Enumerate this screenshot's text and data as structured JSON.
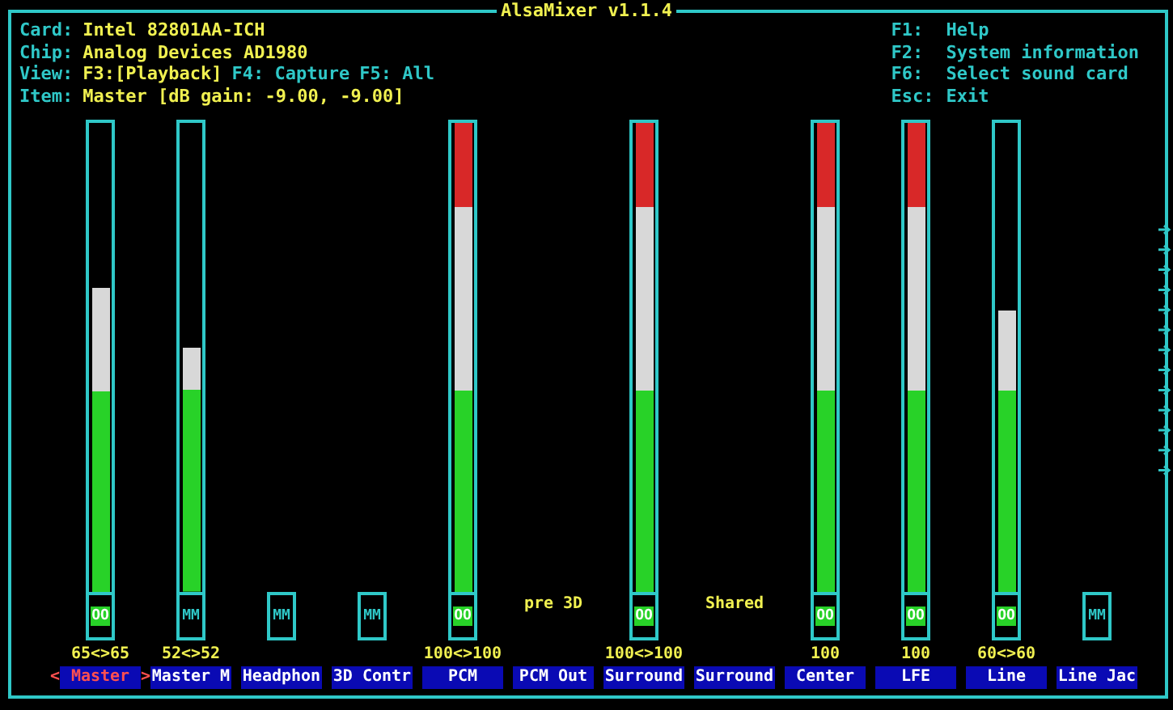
{
  "title": "AlsaMixer v1.1.4",
  "info": [
    {
      "label": "Card:",
      "value": "Intel 82801AA-ICH"
    },
    {
      "label": "Chip:",
      "value": "Analog Devices AD1980"
    },
    {
      "label": "View:",
      "views": [
        {
          "text": "F3:[Playback]",
          "selected": true
        },
        {
          "text": "F4: Capture",
          "selected": false
        },
        {
          "text": "F5: All",
          "selected": false
        }
      ]
    },
    {
      "label": "Item:",
      "value": "Master [dB gain: -9.00, -9.00]"
    }
  ],
  "help": [
    {
      "key": "F1:",
      "action": "Help"
    },
    {
      "key": "F2:",
      "action": "System information"
    },
    {
      "key": "F6:",
      "action": "Select sound card"
    },
    {
      "key": "Esc:",
      "action": "Exit"
    }
  ],
  "cursor": {
    "left": "<",
    "right": ">"
  },
  "channels": [
    {
      "label": "Master",
      "selected": true,
      "level": 0.65,
      "mute": {
        "text": "OO",
        "on": true
      },
      "reading": "65<>65"
    },
    {
      "label": "Master M",
      "selected": false,
      "level": 0.52,
      "mute": {
        "text": "MM",
        "on": false
      },
      "reading": "52<>52"
    },
    {
      "label": "Headphon",
      "selected": false,
      "mute": {
        "text": "MM",
        "on": false
      }
    },
    {
      "label": "3D Contr",
      "selected": false,
      "mute": {
        "text": "MM",
        "on": false
      }
    },
    {
      "label": "PCM",
      "selected": false,
      "level": 1,
      "mute": {
        "text": "OO",
        "on": true
      },
      "reading": "100<>100"
    },
    {
      "label": "PCM Out",
      "selected": false,
      "note": "pre 3D"
    },
    {
      "label": "Surround",
      "selected": false,
      "level": 1,
      "mute": {
        "text": "OO",
        "on": true
      },
      "reading": "100<>100"
    },
    {
      "label": "Surround",
      "selected": false,
      "note": "Shared"
    },
    {
      "label": "Center",
      "selected": false,
      "level": 1,
      "mute": {
        "text": "OO",
        "on": true
      },
      "reading": "100"
    },
    {
      "label": "LFE",
      "selected": false,
      "level": 1,
      "mute": {
        "text": "OO",
        "on": true
      },
      "reading": "100"
    },
    {
      "label": "Line",
      "selected": false,
      "level": 0.6,
      "mute": {
        "text": "OO",
        "on": true
      },
      "reading": "60<>60"
    },
    {
      "label": "Line Jac",
      "selected": false,
      "mute": {
        "text": "MM",
        "on": false
      }
    }
  ]
}
